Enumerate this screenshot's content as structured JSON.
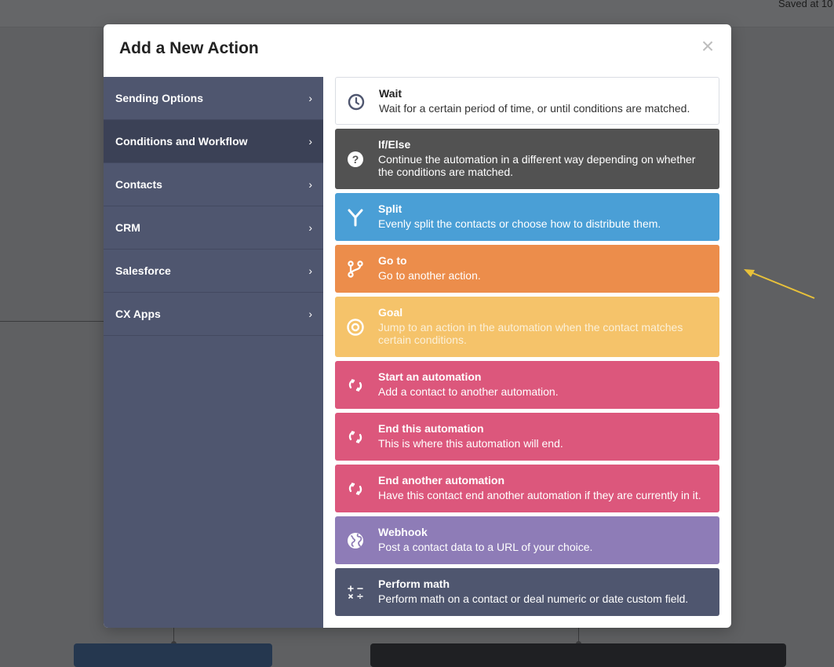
{
  "page": {
    "saved_text": "Saved at 10"
  },
  "modal": {
    "title": "Add a New Action",
    "close_symbol": "×"
  },
  "sidebar": {
    "chevron": "›",
    "items": [
      {
        "label": "Sending Options",
        "active": false
      },
      {
        "label": "Conditions and Workflow",
        "active": true
      },
      {
        "label": "Contacts",
        "active": false
      },
      {
        "label": "CRM",
        "active": false
      },
      {
        "label": "Salesforce",
        "active": false
      },
      {
        "label": "CX Apps",
        "active": false
      }
    ]
  },
  "actions": [
    {
      "title": "Wait",
      "description": "Wait for a certain period of time, or until conditions are matched.",
      "color": "#ffffff",
      "icon": "clock-icon"
    },
    {
      "title": "If/Else",
      "description": "Continue the automation in a different way depending on whether the conditions are matched.",
      "color": "#525252",
      "icon": "question-icon"
    },
    {
      "title": "Split",
      "description": "Evenly split the contacts or choose how to distribute them.",
      "color": "#4a9fd6",
      "icon": "split-icon"
    },
    {
      "title": "Go to",
      "description": "Go to another action.",
      "color": "#ec8d4b",
      "icon": "branch-icon"
    },
    {
      "title": "Goal",
      "description": "Jump to an action in the automation when the contact matches certain conditions.",
      "color": "#f5c36a",
      "icon": "target-icon"
    },
    {
      "title": "Start an automation",
      "description": "Add a contact to another automation.",
      "color": "#dc577c",
      "icon": "cycle-icon"
    },
    {
      "title": "End this automation",
      "description": "This is where this automation will end.",
      "color": "#dc577c",
      "icon": "cycle-icon"
    },
    {
      "title": "End another automation",
      "description": "Have this contact end another automation if they are currently in it.",
      "color": "#dc577c",
      "icon": "cycle-icon"
    },
    {
      "title": "Webhook",
      "description": "Post a contact data to a URL of your choice.",
      "color": "#8e7cb7",
      "icon": "globe-icon"
    },
    {
      "title": "Perform math",
      "description": "Perform math on a contact or deal numeric or date custom field.",
      "color": "#4f566f",
      "icon": "math-icon"
    }
  ],
  "colors": {
    "sidebar_bg": "#4f566f",
    "sidebar_active": "#3b4156",
    "annotation_arrow": "#e8c13a"
  }
}
